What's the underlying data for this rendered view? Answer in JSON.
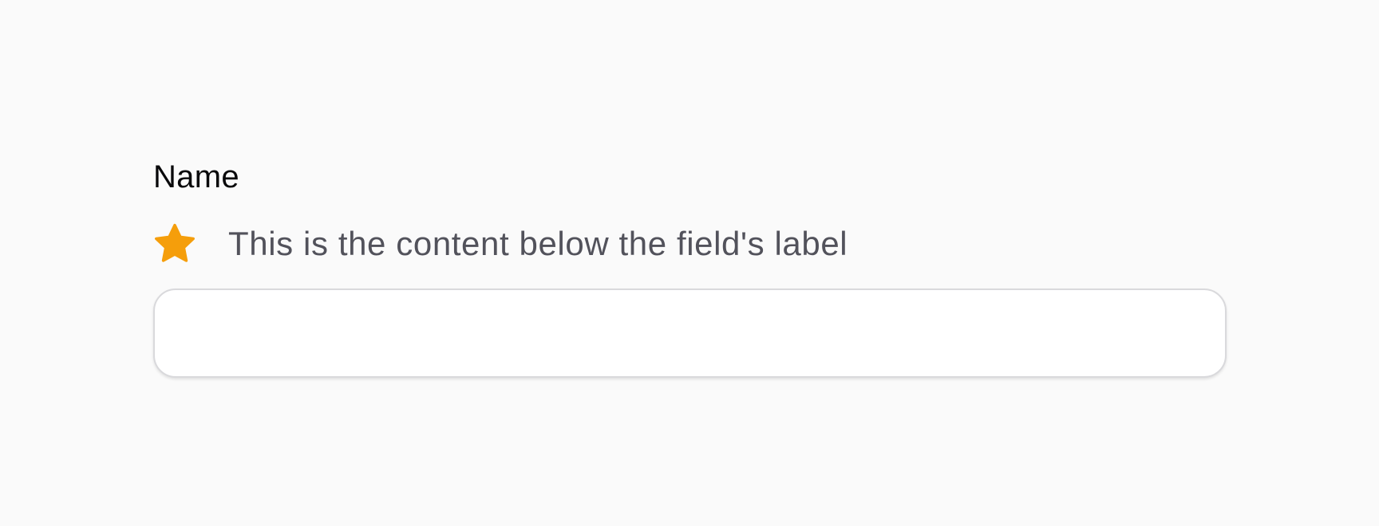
{
  "field": {
    "label": "Name",
    "hint_icon": "star-icon",
    "hint_text": "This is the content below the field's label",
    "input_value": ""
  },
  "colors": {
    "background": "#fafafa",
    "label": "#09090b",
    "hint_text": "#52525b",
    "star": "#f59e0b",
    "input_border": "#d9d9dc",
    "input_background": "#ffffff"
  }
}
